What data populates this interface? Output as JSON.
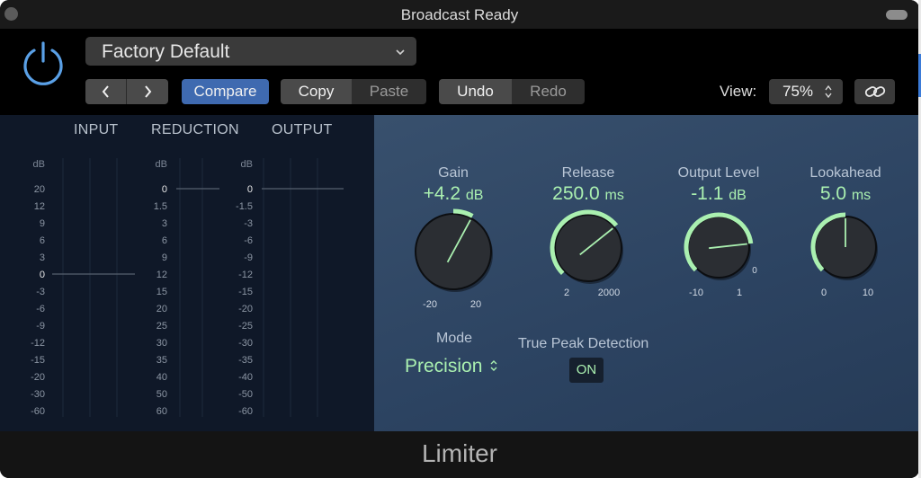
{
  "window": {
    "title": "Broadcast Ready"
  },
  "header": {
    "preset": "Factory Default",
    "buttons": {
      "prev": "‹",
      "next": "›",
      "compare": "Compare",
      "copy": "Copy",
      "paste": "Paste",
      "undo": "Undo",
      "redo": "Redo"
    },
    "view_label": "View:",
    "view_value": "75%"
  },
  "meters": {
    "headers": [
      "INPUT",
      "REDUCTION",
      "OUTPUT"
    ],
    "unit": "dB",
    "input_scale": [
      "20",
      "12",
      "9",
      "6",
      "3",
      "0",
      "-3",
      "-6",
      "-9",
      "-12",
      "-15",
      "-20",
      "-30",
      "-60"
    ],
    "reduction_scale": [
      "0",
      "1.5",
      "3",
      "6",
      "9",
      "12",
      "15",
      "20",
      "25",
      "30",
      "35",
      "40",
      "50",
      "60"
    ],
    "output_scale": [
      "0",
      "-1.5",
      "-3",
      "-6",
      "-9",
      "-12",
      "-15",
      "-20",
      "-25",
      "-30",
      "-35",
      "-40",
      "-50",
      "-60"
    ]
  },
  "controls": {
    "knobs": [
      {
        "label": "Gain",
        "value": "+4.2",
        "unit": "dB",
        "min": "-20",
        "max": "20",
        "fraction": 0.605
      },
      {
        "label": "Release",
        "value": "250.0",
        "unit": "ms",
        "min": "2",
        "max": "2000",
        "fraction": 0.69
      },
      {
        "label": "Output Level",
        "value": "-1.1",
        "unit": "dB",
        "min": "-10",
        "max": "1",
        "extra": "0",
        "fraction": 0.81
      },
      {
        "label": "Lookahead",
        "value": "5.0",
        "unit": "ms",
        "min": "0",
        "max": "10",
        "fraction": 0.5
      }
    ],
    "mode": {
      "label": "Mode",
      "value": "Precision"
    },
    "true_peak": {
      "label": "True Peak Detection",
      "value": "ON"
    }
  },
  "footer": {
    "title": "Limiter"
  },
  "colors": {
    "accent_green": "#aaf0b0",
    "compare_blue": "#3f6ab0",
    "power_blue": "#5aa0e6",
    "panel": "#2c4361",
    "meter_bg": "#0f1828"
  }
}
